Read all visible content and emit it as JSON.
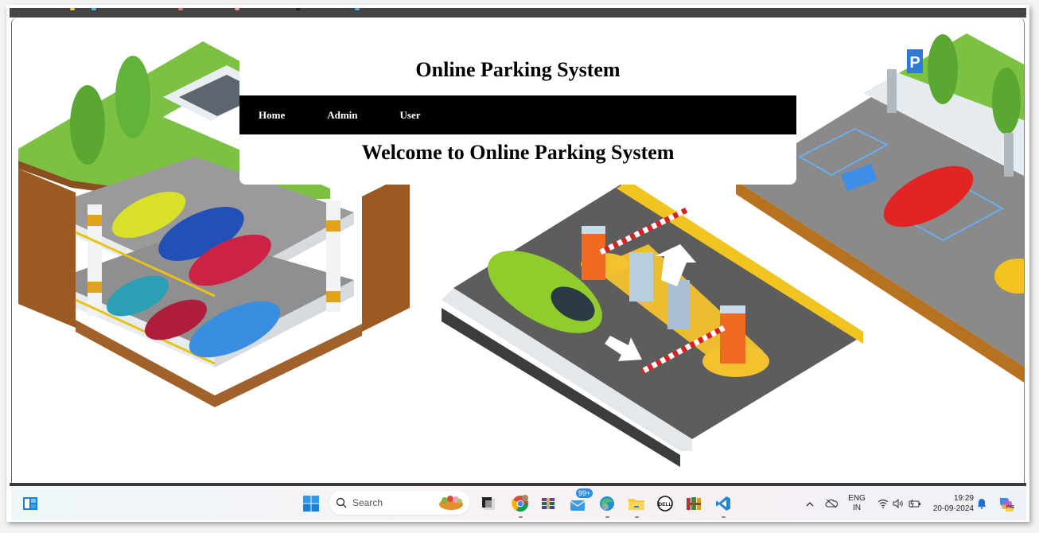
{
  "site": {
    "title": "Online Parking System",
    "nav": [
      {
        "label": "Home"
      },
      {
        "label": "Admin"
      },
      {
        "label": "User"
      }
    ],
    "welcome": "Welcome to Online Parking System"
  },
  "background_illustration": {
    "left": "multi-level parking garage with cars",
    "center": "parking entrance with barrier gates and ticket machines",
    "right": "outdoor parking lot with accessible spot and parking sign",
    "sign_letter": "P"
  },
  "taskbar": {
    "search_placeholder": "Search",
    "apps": [
      {
        "name": "widgets"
      },
      {
        "name": "start"
      },
      {
        "name": "search"
      },
      {
        "name": "task-view"
      },
      {
        "name": "chrome"
      },
      {
        "name": "winrar"
      },
      {
        "name": "mail",
        "badge": "99+"
      },
      {
        "name": "edge"
      },
      {
        "name": "file-explorer"
      },
      {
        "name": "dell"
      },
      {
        "name": "winrar-2"
      },
      {
        "name": "vscode"
      }
    ],
    "tray": {
      "language_line1": "ENG",
      "language_line2": "IN",
      "time": "19:29",
      "date": "20-09-2024",
      "copilot_badge": "PRE"
    }
  },
  "colors": {
    "nav_bg": "#000000",
    "nav_text": "#ffffff",
    "title_text": "#000000",
    "card_bg": "#ffffff"
  }
}
